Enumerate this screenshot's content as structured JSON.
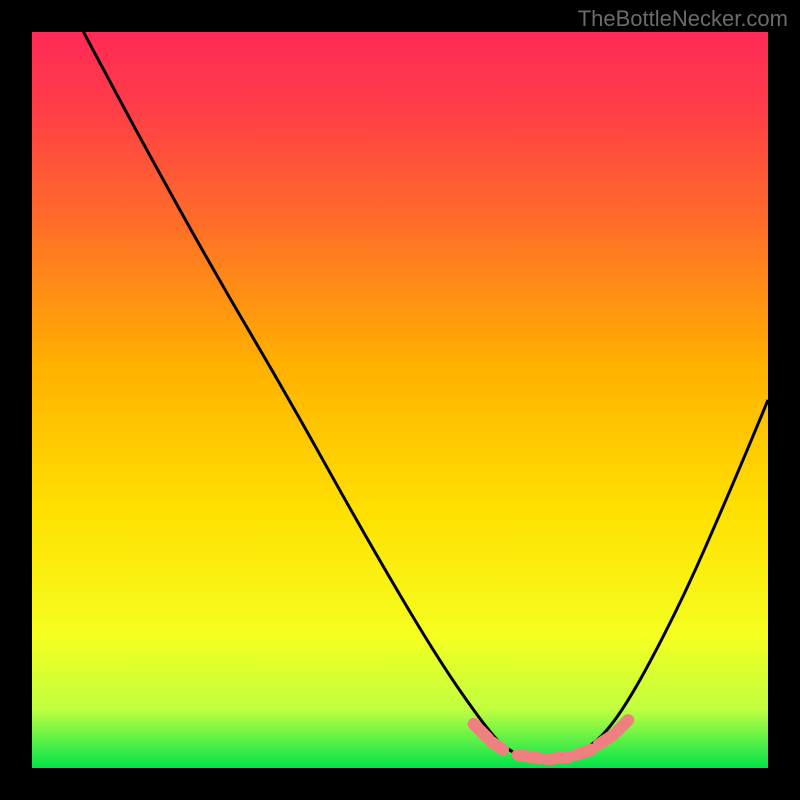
{
  "watermark": "TheBottleNecker.com",
  "chart_data": {
    "type": "line",
    "title": "",
    "xlabel": "",
    "ylabel": "",
    "xlim": [
      0,
      100
    ],
    "ylim": [
      0,
      100
    ],
    "background_gradient_top": "#ff2a55",
    "background_gradient_mid": "#ffd500",
    "background_gradient_bottom": "#00e34a",
    "curve": {
      "comment": "V-shaped curve: descends from top-left, bottoms around x=65-75, ascends to mid-right",
      "points_normalized_0_100": [
        {
          "x": 7,
          "y": 100
        },
        {
          "x": 15,
          "y": 85
        },
        {
          "x": 25,
          "y": 67
        },
        {
          "x": 35,
          "y": 50
        },
        {
          "x": 45,
          "y": 32
        },
        {
          "x": 55,
          "y": 15
        },
        {
          "x": 62,
          "y": 5
        },
        {
          "x": 65,
          "y": 2
        },
        {
          "x": 70,
          "y": 1
        },
        {
          "x": 75,
          "y": 2
        },
        {
          "x": 80,
          "y": 7
        },
        {
          "x": 88,
          "y": 22
        },
        {
          "x": 95,
          "y": 38
        },
        {
          "x": 100,
          "y": 50
        }
      ]
    },
    "highlight_band": {
      "color": "#f08080",
      "y_normalized": 5,
      "x_start": 61,
      "x_end": 80
    }
  }
}
